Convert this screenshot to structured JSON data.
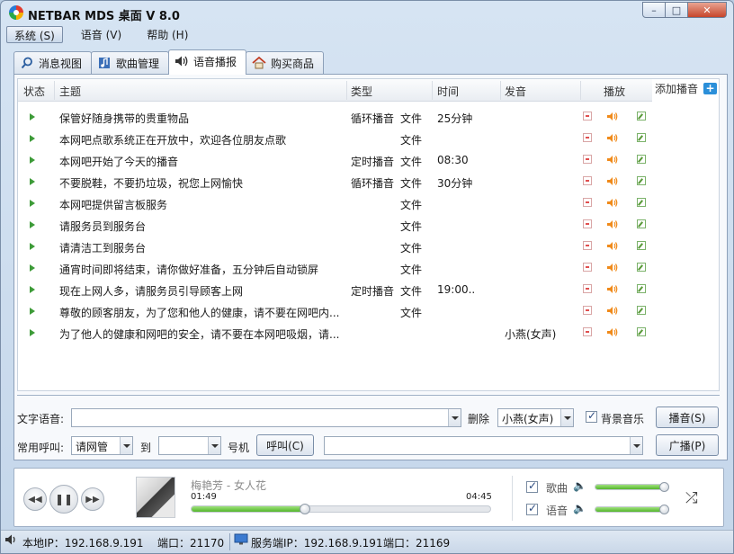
{
  "window": {
    "title": "NETBAR MDS 桌面 V 8.0",
    "min": "–",
    "max": "□",
    "close": "✕"
  },
  "menu": [
    {
      "label": "系统 (S)"
    },
    {
      "label": "语音 (V)"
    },
    {
      "label": "帮助 (H)"
    }
  ],
  "tabs": [
    {
      "label": "消息视图",
      "icon": "search-icon"
    },
    {
      "label": "歌曲管理",
      "icon": "music-note-icon"
    },
    {
      "label": "语音播报",
      "icon": "speaker-icon"
    },
    {
      "label": "购买商品",
      "icon": "home-icon"
    }
  ],
  "grid": {
    "headers": {
      "status": "状态",
      "subject": "主题",
      "type": "类型",
      "time": "时间",
      "voice": "发音",
      "play": "播放"
    },
    "add_label": "添加播音",
    "add_plus": "+",
    "rows": [
      {
        "subject": "保管好随身携带的贵重物品",
        "mode": "循环播音",
        "kind": "文件",
        "time": "25分钟",
        "voice": ""
      },
      {
        "subject": "本网吧点歌系统正在开放中，欢迎各位朋友点歌",
        "mode": "",
        "kind": "文件",
        "time": "",
        "voice": ""
      },
      {
        "subject": "本网吧开始了今天的播音",
        "mode": "定时播音",
        "kind": "文件",
        "time": "08:30",
        "voice": ""
      },
      {
        "subject": "不要脱鞋，不要扔垃圾，祝您上网愉快",
        "mode": "循环播音",
        "kind": "文件",
        "time": "30分钟",
        "voice": ""
      },
      {
        "subject": "本网吧提供留言板服务",
        "mode": "",
        "kind": "文件",
        "time": "",
        "voice": ""
      },
      {
        "subject": "请服务员到服务台",
        "mode": "",
        "kind": "文件",
        "time": "",
        "voice": ""
      },
      {
        "subject": "请清洁工到服务台",
        "mode": "",
        "kind": "文件",
        "time": "",
        "voice": ""
      },
      {
        "subject": "通宵时间即将结束，请你做好准备，五分钟后自动锁屏",
        "mode": "",
        "kind": "文件",
        "time": "",
        "voice": ""
      },
      {
        "subject": "现在上网人多，请服务员引导顾客上网",
        "mode": "定时播音",
        "kind": "文件",
        "time": "19:00..",
        "voice": ""
      },
      {
        "subject": "尊敬的顾客朋友，为了您和他人的健康，请不要在网吧内...",
        "mode": "",
        "kind": "文件",
        "time": "",
        "voice": ""
      },
      {
        "subject": "为了他人的健康和网吧的安全，请不要在本网吧吸烟，请...",
        "mode": "",
        "kind": "",
        "time": "",
        "voice": "小燕(女声)"
      }
    ]
  },
  "tts": {
    "label": "文字语音:",
    "value": "",
    "delete_label": "删除",
    "voice_value": "小燕(女声)",
    "bgm_label": "背景音乐",
    "bgm_checked": true,
    "play_button": "播音(S)"
  },
  "call": {
    "label": "常用呼叫:",
    "target_value": "请网管",
    "to_label": "到",
    "to_value": "",
    "number_label": "号机",
    "call_button": "呼叫(C)",
    "broadcast_value": "",
    "broadcast_button": "广播(P)"
  },
  "player": {
    "prev": "◀◀",
    "pause": "❚❚",
    "next": "▶▶",
    "track": "梅艳芳 - 女人花",
    "current": "01:49",
    "total": "04:45",
    "progress": 0.38,
    "song_label": "歌曲",
    "song_checked": true,
    "song_volume": 0.95,
    "voice_label": "语音",
    "voice_checked": true,
    "voice_volume": 0.95,
    "shuffle": "⤮",
    "speaker_glyph": "🔈"
  },
  "status": {
    "local_ip_label": "本地IP：192.168.9.191",
    "local_port_label": "端口：21170",
    "server_ip_label": "服务端IP：192.168.9.191",
    "server_port_label": "端口：21169"
  },
  "colors": {
    "accent": "#2b8fd9",
    "play_green": "#3d9b38",
    "progress_green": "#53b52b",
    "speaker_orange": "#f08a1a"
  }
}
